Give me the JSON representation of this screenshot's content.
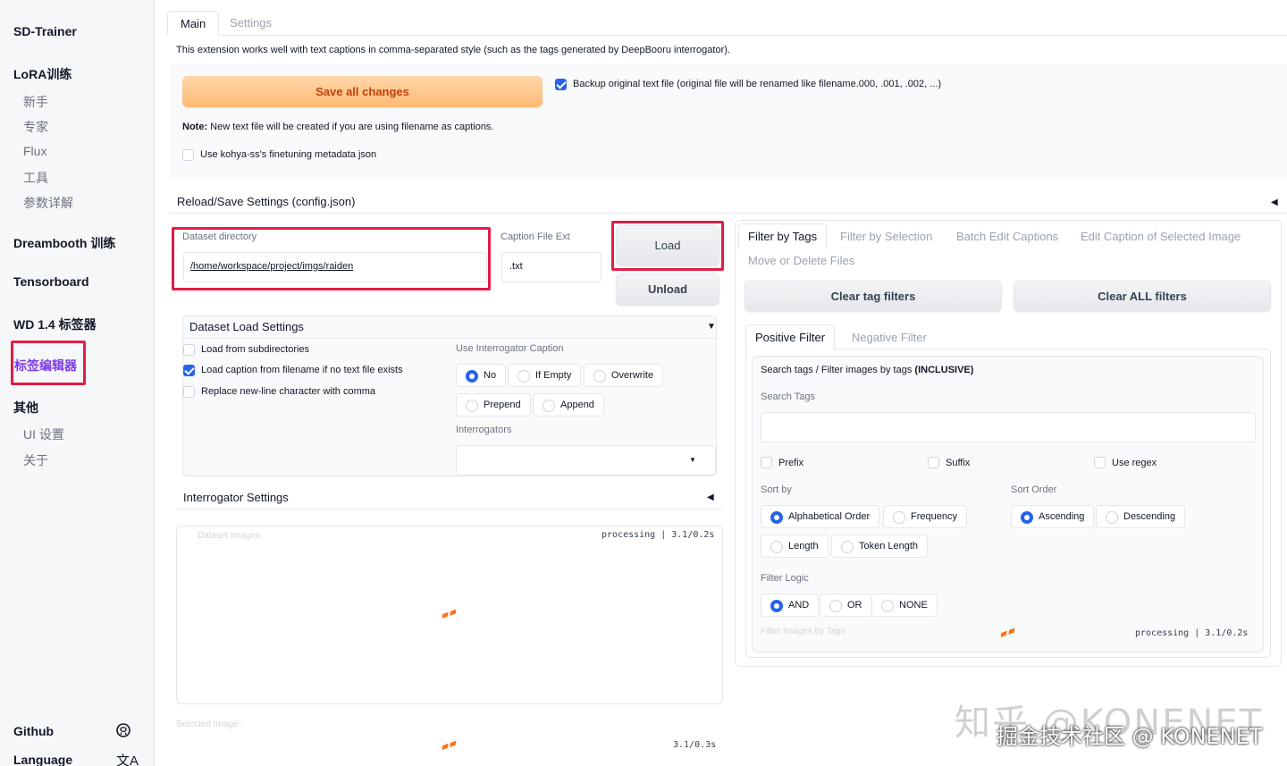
{
  "sidebar": {
    "brand": "SD-Trainer",
    "lora_section": "LoRA训练",
    "lora_items": [
      "新手",
      "专家",
      "Flux",
      "工具",
      "参数详解"
    ],
    "dreambooth": "Dreambooth 训练",
    "tensorboard": "Tensorboard",
    "wd14": "WD 1.4 标签器",
    "tag_editor": "标签编辑器",
    "other": "其他",
    "other_items": [
      "UI 设置",
      "关于"
    ],
    "github": "Github",
    "language": "Language"
  },
  "tabs": [
    "Main",
    "Settings"
  ],
  "intro": "This extension works well with text captions in comma-separated style (such as the tags generated by DeepBooru interrogator).",
  "save_all": "Save all changes",
  "backup_label": "Backup original text file (original file will be renamed like filename.000, .001, .002, ...)",
  "note_prefix": "Note:",
  "note_text": " New text file will be created if you are using filename as captions.",
  "kohya_label": "Use kohya-ss's finetuning metadata json",
  "reload_save": "Reload/Save Settings (config.json)",
  "dataset_dir_label": "Dataset directory",
  "dataset_dir_value": "/home/workspace/project/imgs/raiden",
  "caption_ext_label": "Caption File Ext",
  "caption_ext_value": ".txt",
  "load": "Load",
  "unload": "Unload",
  "dataset_load_settings": "Dataset Load Settings",
  "load_subdirs": "Load from subdirectories",
  "load_caption_filename": "Load caption from filename if no text file exists",
  "replace_newline": "Replace new-line character with comma",
  "use_interrogator_caption": "Use Interrogator Caption",
  "interrogator_options": [
    "No",
    "If Empty",
    "Overwrite",
    "Prepend",
    "Append"
  ],
  "interrogators_label": "Interrogators",
  "interrogator_settings": "Interrogator Settings",
  "dataset_images": "Dataset Images",
  "processing_1": "processing | 3.1/0.2s",
  "selected_image": "Selected Image :",
  "timing_bottom": "3.1/0.3s",
  "right_tabs": [
    "Filter by Tags",
    "Filter by Selection",
    "Batch Edit Captions",
    "Edit Caption of Selected Image",
    "Move or Delete Files"
  ],
  "clear_tag_filters": "Clear tag filters",
  "clear_all_filters": "Clear ALL filters",
  "filter_tabs": [
    "Positive Filter",
    "Negative Filter"
  ],
  "search_desc_prefix": "Search tags / Filter images by tags ",
  "search_desc_bold": "(INCLUSIVE)",
  "search_tags_label": "Search Tags",
  "prefix": "Prefix",
  "suffix": "Suffix",
  "use_regex": "Use regex",
  "sort_by": "Sort by",
  "sort_by_options": [
    "Alphabetical Order",
    "Frequency",
    "Length",
    "Token Length"
  ],
  "sort_order": "Sort Order",
  "sort_order_options": [
    "Ascending",
    "Descending"
  ],
  "filter_logic": "Filter Logic",
  "filter_logic_options": [
    "AND",
    "OR",
    "NONE"
  ],
  "filter_images_by_tags": "Filter Images by Tags",
  "processing_2": "processing | 3.1/0.2s",
  "watermark_1": "知乎 @KONENET",
  "watermark_2": "掘金技术社区 @ KONENET",
  "colors": {
    "accent": "#2563eb",
    "highlight": "#e11d48",
    "save_text": "#c2410c",
    "active_nav": "#7c3aed"
  }
}
